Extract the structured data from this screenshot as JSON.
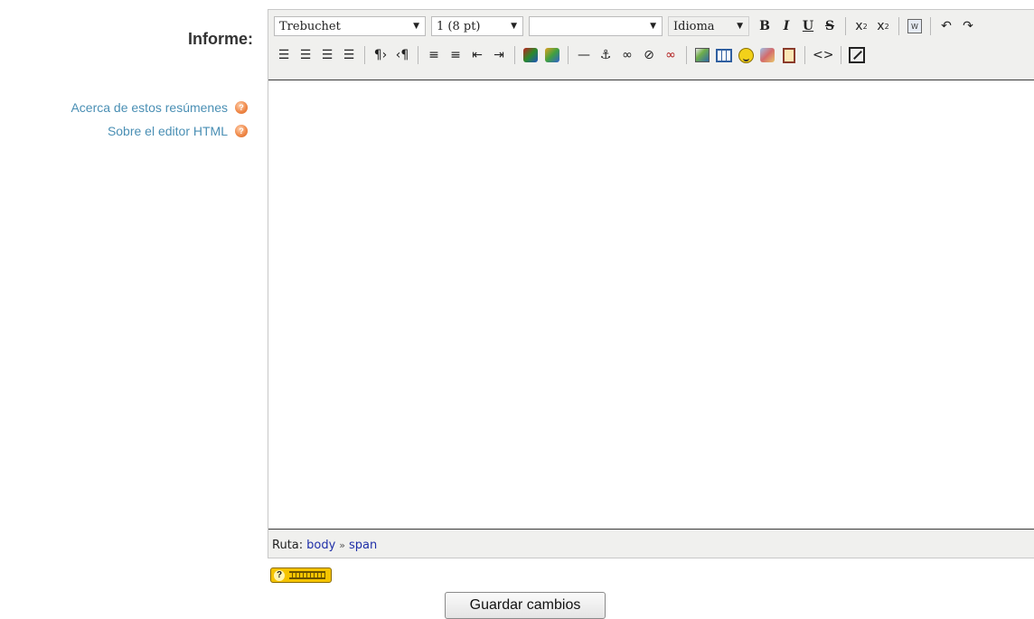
{
  "form": {
    "label": "Informe:",
    "save_button": "Guardar cambios"
  },
  "help": [
    {
      "text": "Acerca de estos resúmenes",
      "icon": "help-icon"
    },
    {
      "text": "Sobre el editor HTML",
      "icon": "help-icon"
    }
  ],
  "toolbar": {
    "font_family": "Trebuchet",
    "font_size": "1 (8 pt)",
    "paragraph_style": "",
    "language": "Idioma",
    "bold": "B",
    "italic": "I",
    "underline": "U",
    "strikethrough": "S"
  },
  "path": {
    "label": "Ruta:",
    "items": [
      "body",
      "span"
    ],
    "separator": "»"
  },
  "colors": {
    "link": "#4a8fb4",
    "path_link": "#1f2fa8",
    "toolbar_bg": "#f0f0ee",
    "badge": "#f5c400"
  }
}
